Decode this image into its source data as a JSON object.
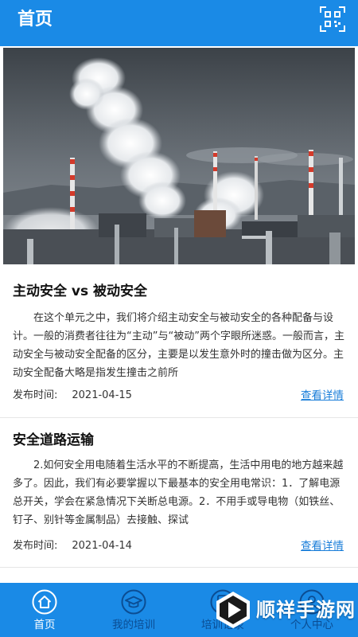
{
  "header": {
    "title": "首页",
    "qr_icon": "qr-scan-icon",
    "bg_color": "#1a8ae6"
  },
  "hero": {
    "image_icon": "industrial-chimney-smoke-photo"
  },
  "articles": [
    {
      "title": "主动安全 vs 被动安全",
      "body": "在这个单元之中，我们将介绍主动安全与被动安全的各种配备与设计。一般的消费者往往为“主动”与“被动”两个字眼所迷惑。一般而言，主动安全与被动安全配备的区分，主要是以发生意外时的撞击做为区分。主动安全配备大略是指发生撞击之前所",
      "date_label": "发布时间:",
      "date": "2021-04-15",
      "detail_label": "查看详情"
    },
    {
      "title": "安全道路运输",
      "body": "2.如何安全用电随着生活水平的不断提高，生活中用电的地方越来越多了。因此，我们有必要掌握以下最基本的安全用电常识：1．了解电源总开关，学会在紧急情况下关断总电源。2．不用手或导电物（如铁丝、钉子、别针等金属制品）去接触、探试",
      "date_label": "发布时间:",
      "date": "2021-04-14",
      "detail_label": "查看详情"
    }
  ],
  "tabbar": {
    "tabs": [
      {
        "label": "首页",
        "icon": "home-icon",
        "active": true
      },
      {
        "label": "我的培训",
        "icon": "graduation-cap-icon",
        "active": false
      },
      {
        "label": "培训记录",
        "icon": "record-icon",
        "active": false
      },
      {
        "label": "个人中心",
        "icon": "user-icon",
        "active": false
      }
    ]
  },
  "watermark": {
    "text": "顺祥手游网",
    "icon": "play-logo-icon"
  },
  "colors": {
    "accent": "#1a8ae6",
    "link": "#1a7ed9"
  }
}
